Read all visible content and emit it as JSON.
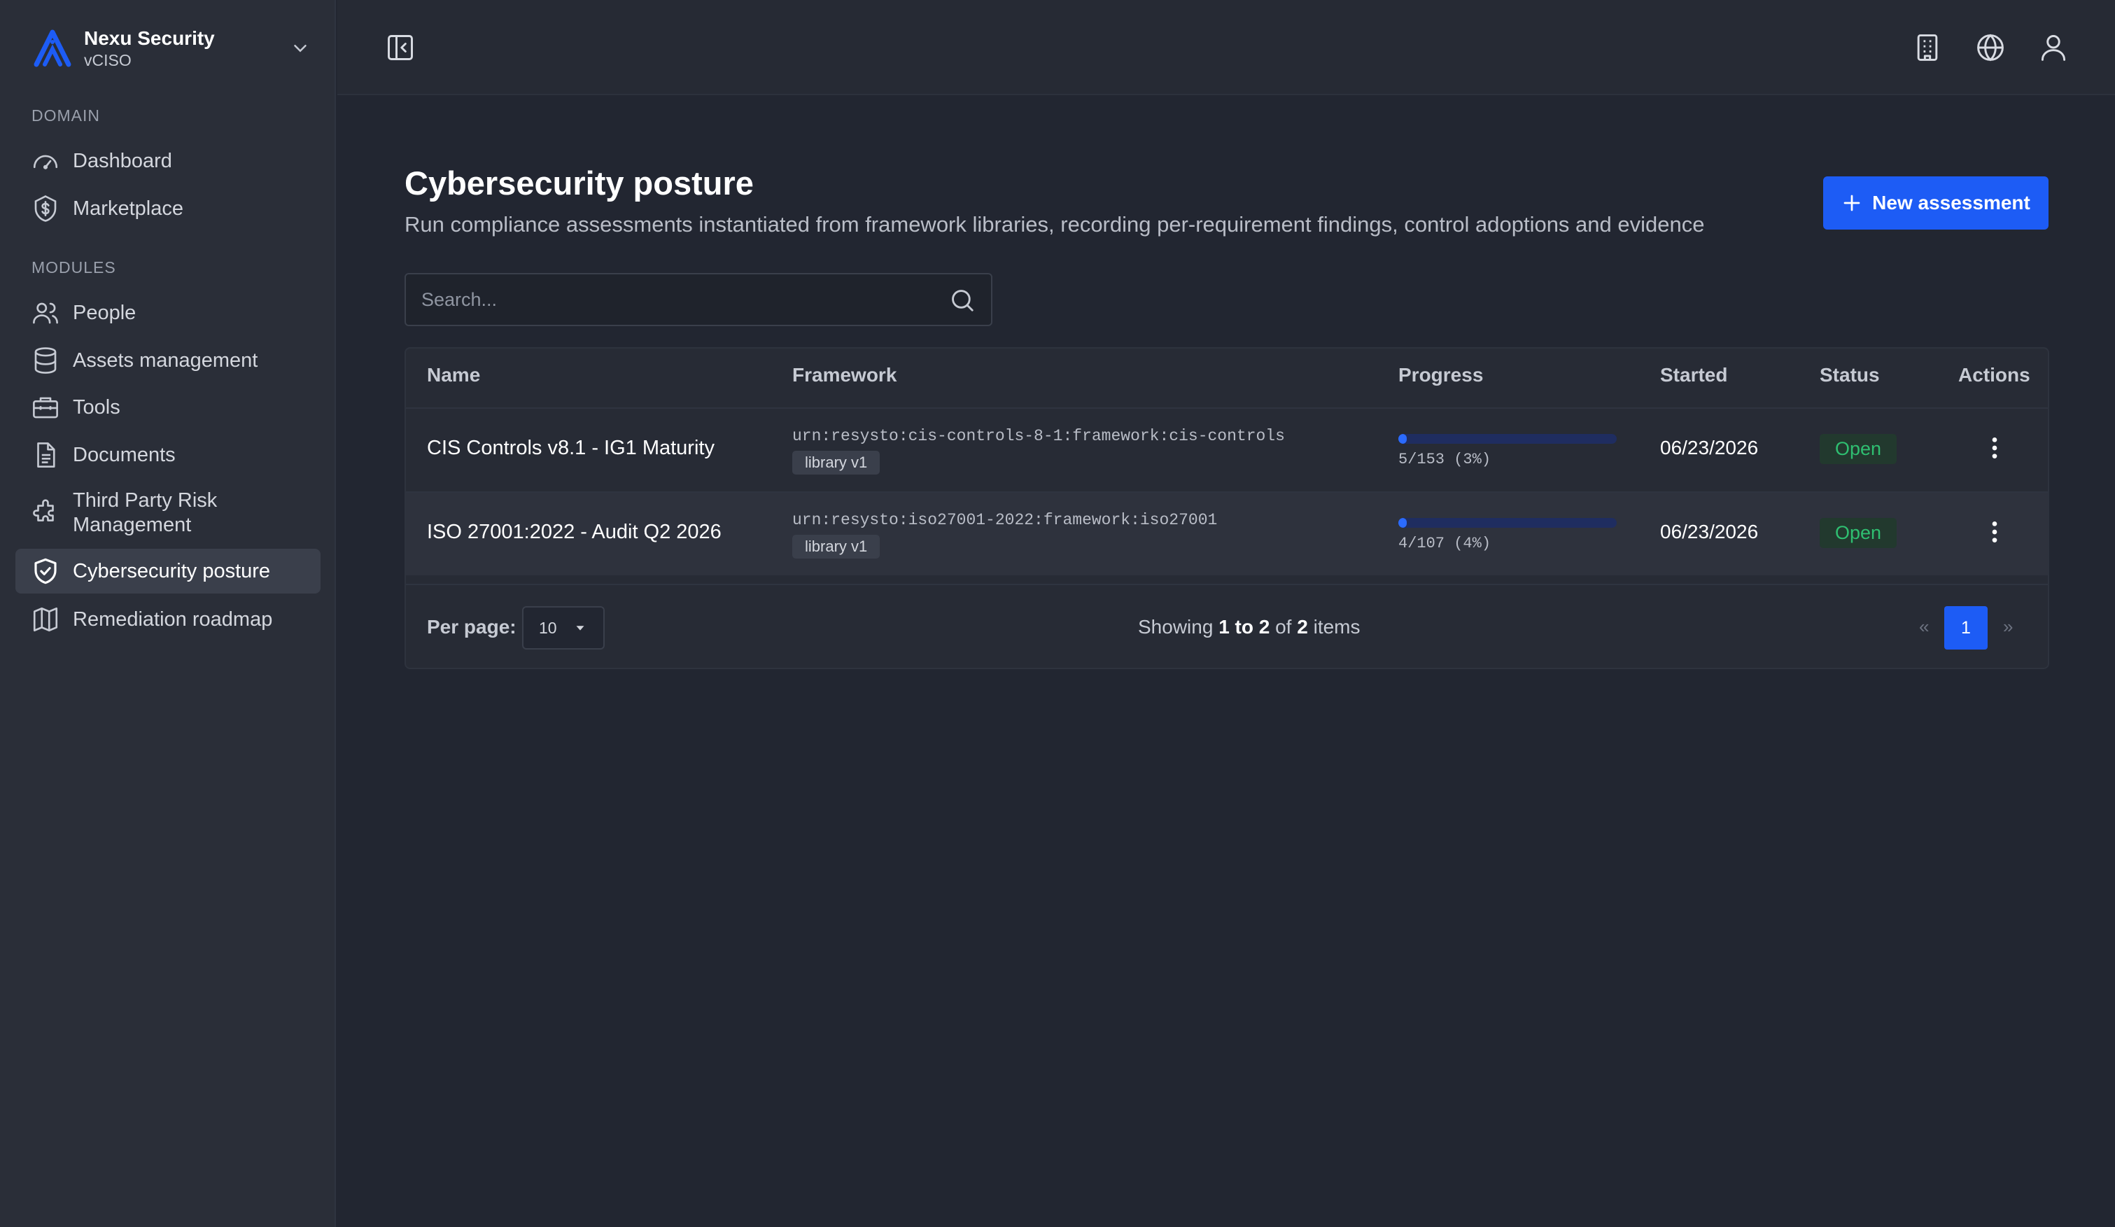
{
  "brand": {
    "name": "Nexu Security",
    "subtitle": "vCISO",
    "accent": "#1d5cf5"
  },
  "sidebar": {
    "sections": [
      {
        "label": "DOMAIN",
        "items": [
          {
            "label": "Dashboard",
            "icon": "gauge-icon"
          },
          {
            "label": "Marketplace",
            "icon": "dollar-coin-icon"
          }
        ]
      },
      {
        "label": "MODULES",
        "items": [
          {
            "label": "People",
            "icon": "users-icon"
          },
          {
            "label": "Assets management",
            "icon": "database-icon"
          },
          {
            "label": "Tools",
            "icon": "toolbox-icon"
          },
          {
            "label": "Documents",
            "icon": "document-icon"
          },
          {
            "label": "Third Party Risk Management",
            "icon": "puzzle-icon"
          },
          {
            "label": "Cybersecurity posture",
            "icon": "shield-check-icon",
            "active": true
          },
          {
            "label": "Remediation roadmap",
            "icon": "map-icon"
          }
        ]
      }
    ]
  },
  "topbar": {
    "icons": [
      "sidebar-collapse-icon",
      "building-icon",
      "globe-icon",
      "user-icon"
    ]
  },
  "page": {
    "title": "Cybersecurity posture",
    "description": "Run compliance assessments instantiated from framework libraries, recording per-requirement findings, control adoptions and evidence",
    "new_button": "New assessment"
  },
  "search": {
    "placeholder": "Search..."
  },
  "table": {
    "columns": [
      "Name",
      "Framework",
      "Progress",
      "Started",
      "Status",
      "Actions"
    ],
    "rows": [
      {
        "name": "CIS Controls v8.1 - IG1 Maturity",
        "framework_urn": "urn:resysto:cis-controls-8-1:framework:cis-controls",
        "framework_tag": "library v1",
        "progress_text": "5/153 (3%)",
        "progress_fraction": 0.03,
        "started": "06/23/2026",
        "status": "Open"
      },
      {
        "name": "ISO 27001:2022 - Audit Q2 2026",
        "framework_urn": "urn:resysto:iso27001-2022:framework:iso27001",
        "framework_tag": "library v1",
        "progress_text": "4/107 (4%)",
        "progress_fraction": 0.04,
        "started": "06/23/2026",
        "status": "Open"
      }
    ]
  },
  "pagination": {
    "per_page_label": "Per page:",
    "per_page_value": "10",
    "showing_prefix": "Showing",
    "showing_range": "1 to 2",
    "showing_of": "of",
    "showing_total": "2",
    "showing_suffix": "items",
    "prev": "«",
    "current": "1",
    "next": "»"
  },
  "colors": {
    "status_open": "#2fbf71",
    "progress": "#2b6bff",
    "background": "#222631"
  }
}
